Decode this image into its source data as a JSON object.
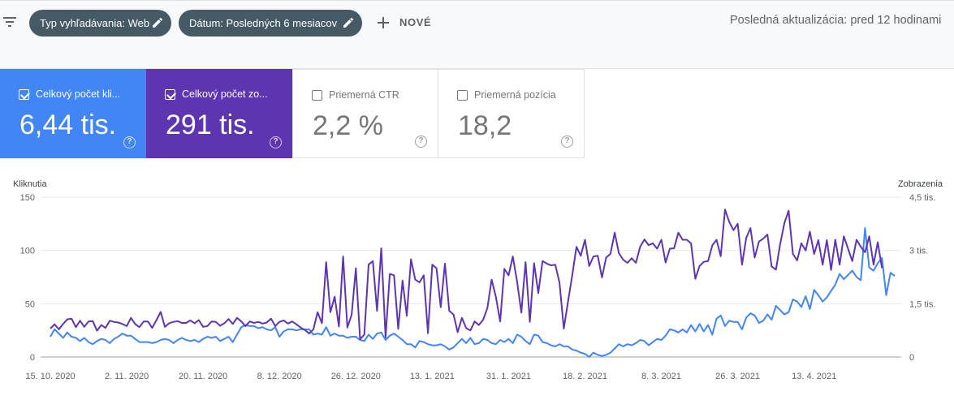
{
  "toolbar": {
    "filter_icon": "filter-list-icon",
    "chip_search_type": "Typ vyhľadávania: Web",
    "chip_date": "Dátum: Posledných 6 mesiacov",
    "new_label": "NOVÉ",
    "last_update": "Posledná aktualizácia: pred 12 hodinami"
  },
  "cards": [
    {
      "label": "Celkový počet kli...",
      "value": "6,44 tis.",
      "checked": true,
      "color": "#4285f4"
    },
    {
      "label": "Celkový počet zo...",
      "value": "291 tis.",
      "checked": true,
      "color": "#5e35b1"
    },
    {
      "label": "Priemerná CTR",
      "value": "2,2 %",
      "checked": false
    },
    {
      "label": "Priemerná pozícia",
      "value": "18,2",
      "checked": false
    }
  ],
  "chart_data": {
    "type": "line",
    "ylabel_left": "Kliknutia",
    "ylabel_right": "Zobrazenia",
    "left_ticks": [
      "0",
      "50",
      "100",
      "150"
    ],
    "left_range": [
      0,
      150
    ],
    "right_ticks": [
      "0",
      "1,5 tis.",
      "3 tis.",
      "4,5 tis."
    ],
    "right_range": [
      0,
      4500
    ],
    "x_tick_labels": [
      "15. 10. 2020",
      "2. 11. 2020",
      "20. 11. 2020",
      "8. 12. 2020",
      "26. 12. 2020",
      "13. 1. 2021",
      "31. 1. 2021",
      "18. 2. 2021",
      "8. 3. 2021",
      "26. 3. 2021",
      "13. 4. 2021"
    ],
    "x_tick_index": [
      0,
      18,
      36,
      54,
      72,
      90,
      108,
      126,
      144,
      162,
      180
    ],
    "series": [
      {
        "name": "Kliknutia",
        "axis": "left",
        "color": "#4285f4",
        "values": [
          19,
          26,
          22,
          18,
          23,
          19,
          18,
          15,
          18,
          14,
          12,
          15,
          17,
          16,
          13,
          17,
          19,
          22,
          20,
          20,
          17,
          14,
          14,
          14,
          13,
          14,
          16,
          17,
          16,
          13,
          16,
          18,
          16,
          15,
          16,
          14,
          17,
          19,
          18,
          19,
          15,
          17,
          19,
          14,
          21,
          28,
          30,
          29,
          29,
          27,
          28,
          26,
          25,
          28,
          19,
          24,
          26,
          26,
          25,
          26,
          26,
          26,
          21,
          22,
          21,
          28,
          20,
          22,
          20,
          20,
          18,
          19,
          19,
          16,
          15,
          21,
          17,
          22,
          23,
          16,
          20,
          22,
          19,
          16,
          12,
          12,
          9,
          15,
          14,
          12,
          11,
          11,
          12,
          10,
          7,
          9,
          13,
          17,
          13,
          18,
          12,
          13,
          17,
          16,
          13,
          12,
          16,
          14,
          17,
          13,
          21,
          19,
          15,
          12,
          21,
          20,
          14,
          13,
          11,
          10,
          12,
          10,
          10,
          7,
          6,
          4,
          3,
          0,
          4,
          2,
          1,
          2,
          4,
          8,
          12,
          10,
          12,
          11,
          13,
          16,
          15,
          11,
          14,
          17,
          16,
          20,
          26,
          25,
          23,
          26,
          23,
          30,
          24,
          31,
          24,
          30,
          21,
          36,
          39,
          29,
          34,
          33,
          33,
          26,
          37,
          41,
          39,
          32,
          34,
          40,
          35,
          48,
          44,
          40,
          42,
          54,
          52,
          47,
          57,
          45,
          63,
          58,
          52,
          56,
          62,
          68,
          78,
          73,
          77,
          81,
          75,
          72,
          121,
          84,
          81,
          88,
          93,
          58,
          79,
          76
        ]
      },
      {
        "name": "Zobrazenia",
        "axis": "right",
        "color": "#5e35b1",
        "values": [
          800,
          920,
          780,
          930,
          1060,
          1080,
          840,
          1020,
          850,
          1000,
          1010,
          740,
          900,
          820,
          1020,
          990,
          970,
          930,
          870,
          1100,
          930,
          840,
          1000,
          1000,
          820,
          1040,
          1270,
          850,
          950,
          990,
          1010,
          960,
          960,
          1030,
          950,
          1040,
          850,
          870,
          1000,
          990,
          880,
          950,
          1070,
          930,
          1100,
          1000,
          870,
          1000,
          960,
          990,
          940,
          970,
          1080,
          870,
          990,
          1030,
          940,
          1000,
          920,
          830,
          760,
          660,
          780,
          1260,
          950,
          2670,
          1260,
          1700,
          860,
          2830,
          830,
          1190,
          2500,
          500,
          630,
          2600,
          2700,
          1300,
          3060,
          550,
          2340,
          2300,
          790,
          2150,
          1160,
          2750,
          2180,
          2100,
          2300,
          670,
          2600,
          2500,
          1400,
          2630,
          1300,
          1200,
          700,
          1100,
          810,
          750,
          1000,
          900,
          1050,
          1380,
          2180,
          1700,
          1000,
          2480,
          2300,
          2830,
          2120,
          1250,
          2670,
          990,
          2640,
          1800,
          2700,
          2630,
          2580,
          2600,
          2100,
          800,
          1560,
          2300,
          3100,
          2850,
          3300,
          2560,
          2830,
          2850,
          2240,
          2800,
          2900,
          3500,
          2920,
          2740,
          2650,
          2780,
          2650,
          3100,
          3310,
          3150,
          3200,
          3050,
          3300,
          2660,
          3050,
          3060,
          3500,
          3300,
          3300,
          3200,
          2200,
          2560,
          2680,
          2700,
          3140,
          3300,
          2840,
          4150,
          3800,
          3570,
          3750,
          2600,
          3350,
          3630,
          2800,
          3250,
          3330,
          3450,
          2550,
          2460,
          3180,
          3770,
          4120,
          2900,
          2720,
          3200,
          3000,
          3530,
          2900,
          3290,
          2600,
          3290,
          2450,
          3300,
          2600,
          3400,
          3050,
          2700,
          3300,
          3100,
          2950,
          3400,
          2600,
          3230,
          2500
        ]
      }
    ]
  }
}
